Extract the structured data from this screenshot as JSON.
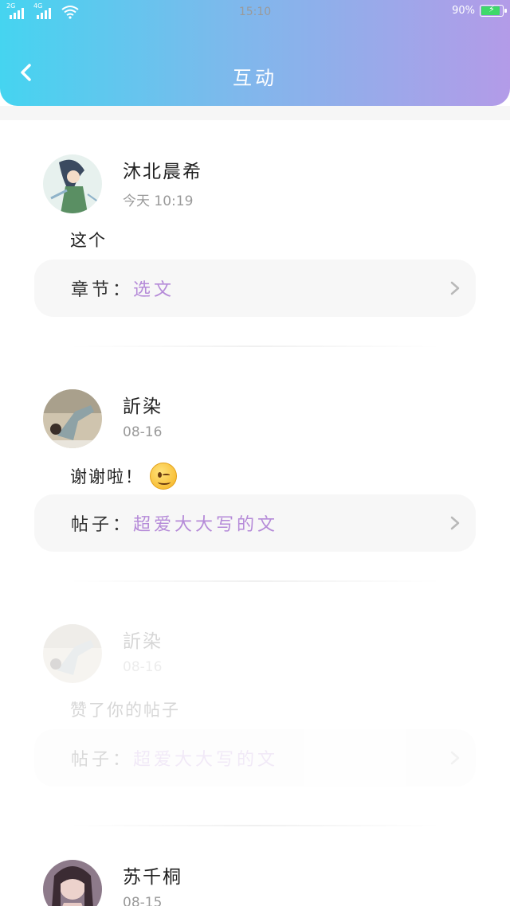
{
  "status_bar": {
    "signal_1_label": "2G",
    "signal_2_label": "4G",
    "time": "15:10",
    "battery_percent": "90%",
    "battery_level": 0.9
  },
  "header": {
    "title": "互动",
    "back_icon": "chevron-left-icon"
  },
  "interactions": [
    {
      "name": "沐北晨希",
      "time": "今天 10:19",
      "content": "这个",
      "link_label": "章节：",
      "link_value": "选文",
      "has_emoji": false
    },
    {
      "name": "訢染",
      "time": "08-16",
      "content": "谢谢啦！",
      "link_label": "帖子：",
      "link_value": "超爱大大写的文",
      "has_emoji": true,
      "emoji": "wink-emoji"
    },
    {
      "name": "訢染",
      "time": "08-16",
      "content": "赞了你的帖子",
      "link_label": "帖子：",
      "link_value": "超爱大大写的文",
      "has_emoji": false
    },
    {
      "name": "苏千桐",
      "time": "08-15",
      "content": "",
      "link_label": "",
      "link_value": "",
      "has_emoji": false
    }
  ],
  "colors": {
    "header_gradient_start": "#45d4f0",
    "header_gradient_end": "#b39be8",
    "link_value": "#b58ad8",
    "secondary_text": "#9a9a9a"
  }
}
